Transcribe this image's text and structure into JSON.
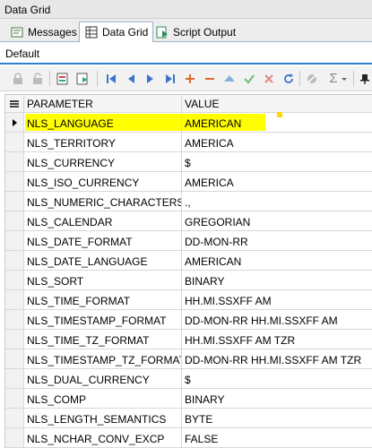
{
  "window": {
    "title": "Data Grid"
  },
  "tabs": [
    {
      "label": "Messages",
      "icon": "messages-icon"
    },
    {
      "label": "Data Grid",
      "icon": "grid-icon",
      "active": true
    },
    {
      "label": "Script Output",
      "icon": "script-output-icon"
    }
  ],
  "subtab": {
    "label": "Default"
  },
  "toolbar": {
    "icons": [
      "lock-icon",
      "unlock-icon",
      "export-icon",
      "import-icon",
      "first-record-icon",
      "previous-record-icon",
      "next-record-icon",
      "last-record-icon",
      "add-row-icon",
      "delete-row-icon",
      "move-up-icon",
      "post-icon",
      "cancel-icon",
      "refresh-icon",
      "filter-icon",
      "sum-icon",
      "dropdown-icon",
      "pin-icon"
    ],
    "sum_symbol": "Σ"
  },
  "grid": {
    "columns": [
      "PARAMETER",
      "VALUE"
    ],
    "rows": [
      {
        "parameter": "NLS_LANGUAGE",
        "value": "AMERICAN",
        "selected": true
      },
      {
        "parameter": "NLS_TERRITORY",
        "value": "AMERICA"
      },
      {
        "parameter": "NLS_CURRENCY",
        "value": "$"
      },
      {
        "parameter": "NLS_ISO_CURRENCY",
        "value": "AMERICA"
      },
      {
        "parameter": "NLS_NUMERIC_CHARACTERS",
        "value": ".,"
      },
      {
        "parameter": "NLS_CALENDAR",
        "value": "GREGORIAN"
      },
      {
        "parameter": "NLS_DATE_FORMAT",
        "value": "DD-MON-RR"
      },
      {
        "parameter": "NLS_DATE_LANGUAGE",
        "value": "AMERICAN"
      },
      {
        "parameter": "NLS_SORT",
        "value": "BINARY"
      },
      {
        "parameter": "NLS_TIME_FORMAT",
        "value": "HH.MI.SSXFF AM"
      },
      {
        "parameter": "NLS_TIMESTAMP_FORMAT",
        "value": "DD-MON-RR HH.MI.SSXFF AM"
      },
      {
        "parameter": "NLS_TIME_TZ_FORMAT",
        "value": "HH.MI.SSXFF AM TZR"
      },
      {
        "parameter": "NLS_TIMESTAMP_TZ_FORMAT",
        "value": "DD-MON-RR HH.MI.SSXFF AM TZR"
      },
      {
        "parameter": "NLS_DUAL_CURRENCY",
        "value": "$"
      },
      {
        "parameter": "NLS_COMP",
        "value": "BINARY"
      },
      {
        "parameter": "NLS_LENGTH_SEMANTICS",
        "value": "BYTE"
      },
      {
        "parameter": "NLS_NCHAR_CONV_EXCP",
        "value": "FALSE"
      }
    ]
  },
  "colors": {
    "highlight": "#ffff00",
    "accent": "#2f7fd1",
    "nav_blue": "#3b74c9"
  }
}
